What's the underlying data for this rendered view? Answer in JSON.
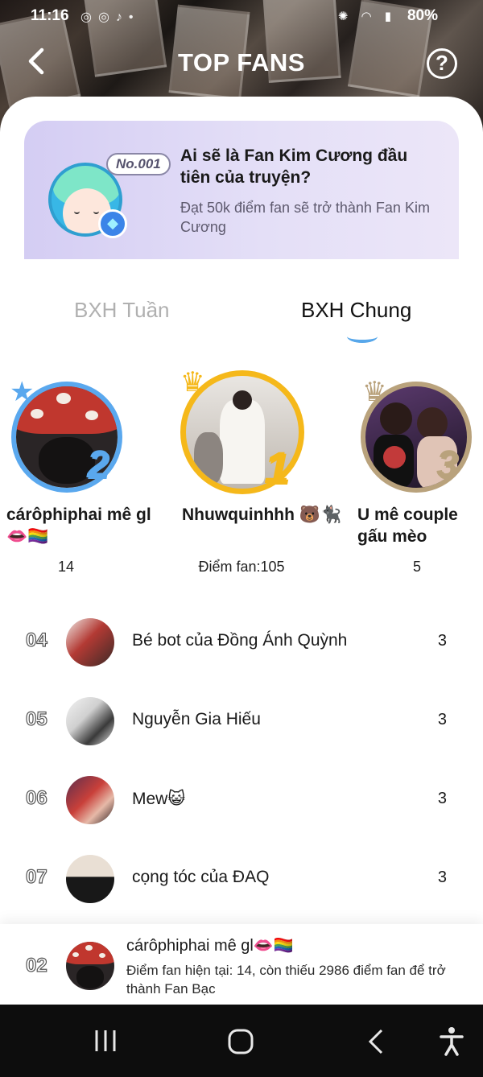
{
  "status": {
    "time": "11:16",
    "battery": "80%"
  },
  "header": {
    "title": "TOP FANS"
  },
  "promo": {
    "badge": "No.001",
    "title": "Ai sẽ là Fan Kim Cương đầu tiên của truyện?",
    "subtitle": "Đạt 50k điểm fan sẽ trở thành Fan Kim Cương"
  },
  "tabs": [
    {
      "label": "BXH Tuần"
    },
    {
      "label": "BXH Chung"
    }
  ],
  "active_tab": "BXH Chung",
  "podium": [
    {
      "rank": "2",
      "name": "cárôphiphai mê gl👄🏳️‍🌈",
      "score": "14"
    },
    {
      "rank": "1",
      "name": "Nhuwquinhhh 🐻🐈‍⬛",
      "score": "Điểm fan:105"
    },
    {
      "rank": "3",
      "name": "U mê couple gấu mèo",
      "score": "5"
    }
  ],
  "list": [
    {
      "rank": "04",
      "name": "Bé bot của Đồng Ánh Quỳnh",
      "score": "3"
    },
    {
      "rank": "05",
      "name": "Nguyễn Gia Hiếu",
      "score": "3"
    },
    {
      "rank": "06",
      "name": "Mew😺",
      "score": "3"
    },
    {
      "rank": "07",
      "name": "cọng tóc của ĐAQ",
      "score": "3"
    }
  ],
  "me": {
    "rank": "02",
    "name": "cárôphiphai mê gl👄🏳️‍🌈",
    "progress": "Điểm fan hiện tại: 14, còn thiếu 2986 điểm fan để trở thành Fan Bạc"
  },
  "colors": {
    "accent": "#58a7ea",
    "silver": "#5aa8ee",
    "gold": "#f5b81a",
    "bronze": "#b9a27c"
  }
}
